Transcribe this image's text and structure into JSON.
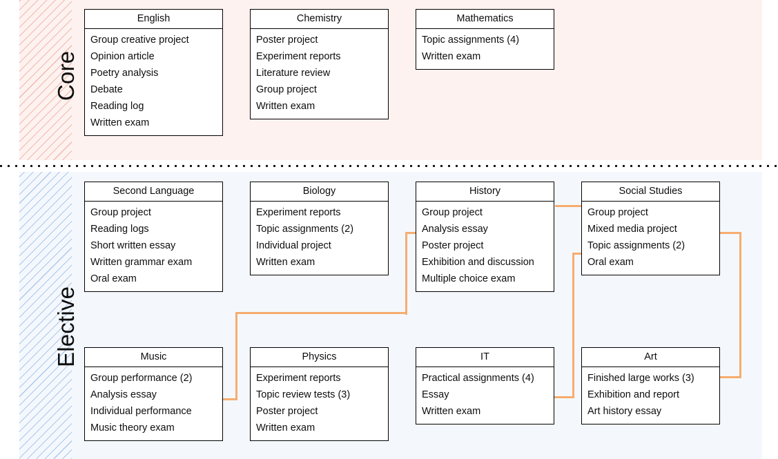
{
  "diagram": {
    "accent_color": "#f7ac6f",
    "core_band_color": "#fdf2ef",
    "elective_band_color": "#f4f8fd",
    "core_hatch_color": "#f0b9ad",
    "elective_hatch_color": "#aec7ea",
    "divider_color": "#1a1a1a"
  },
  "sections": [
    {
      "id": "core",
      "label": "Core"
    },
    {
      "id": "elective",
      "label": "Elective"
    }
  ],
  "cards": [
    {
      "id": "english",
      "section": "core",
      "title": "English",
      "items": [
        "Group creative project",
        "Opinion article",
        "Poetry analysis",
        "Debate",
        "Reading log",
        "Written exam"
      ]
    },
    {
      "id": "chemistry",
      "section": "core",
      "title": "Chemistry",
      "items": [
        "Poster project",
        "Experiment reports",
        "Literature review",
        "Group project",
        "Written exam"
      ]
    },
    {
      "id": "mathematics",
      "section": "core",
      "title": "Mathematics",
      "items": [
        "Topic assignments (4)",
        "Written exam"
      ]
    },
    {
      "id": "second-language",
      "section": "elective",
      "title": "Second Language",
      "items": [
        "Group project",
        "Reading logs",
        "Short written essay",
        "Written grammar exam",
        "Oral exam"
      ]
    },
    {
      "id": "biology",
      "section": "elective",
      "title": "Biology",
      "items": [
        "Experiment reports",
        "Topic assignments (2)",
        "Individual project",
        "Written exam"
      ]
    },
    {
      "id": "history",
      "section": "elective",
      "title": "History",
      "items": [
        "Group project",
        "Analysis essay",
        "Poster project",
        "Exhibition and discussion",
        "Multiple choice exam"
      ]
    },
    {
      "id": "social-studies",
      "section": "elective",
      "title": "Social Studies",
      "items": [
        "Group project",
        "Mixed media project",
        "Topic assignments (2)",
        "Oral exam"
      ]
    },
    {
      "id": "music",
      "section": "elective",
      "title": "Music",
      "items": [
        "Group performance (2)",
        "Analysis essay",
        "Individual performance",
        "Music theory exam"
      ]
    },
    {
      "id": "physics",
      "section": "elective",
      "title": "Physics",
      "items": [
        "Experiment reports",
        "Topic review tests (3)",
        "Poster project",
        "Written exam"
      ]
    },
    {
      "id": "it",
      "section": "elective",
      "title": "IT",
      "items": [
        "Practical assignments (4)",
        "Essay",
        "Written exam"
      ]
    },
    {
      "id": "art",
      "section": "elective",
      "title": "Art",
      "items": [
        "Finished large works (3)",
        "Exhibition and report",
        "Art history essay"
      ]
    }
  ],
  "connections": [
    {
      "id": "history-to-social-studies",
      "from": "History / Group project",
      "to": "Social Studies / Group project"
    },
    {
      "id": "history-to-music",
      "from": "History / Analysis essay",
      "to": "Music / Analysis essay"
    },
    {
      "id": "social-studies-to-it",
      "from": "Social Studies / Topic assignments (2)",
      "to": "IT / Essay"
    },
    {
      "id": "social-studies-to-art",
      "from": "Social Studies / Mixed media project",
      "to": "Art / Finished large works (3)"
    }
  ]
}
